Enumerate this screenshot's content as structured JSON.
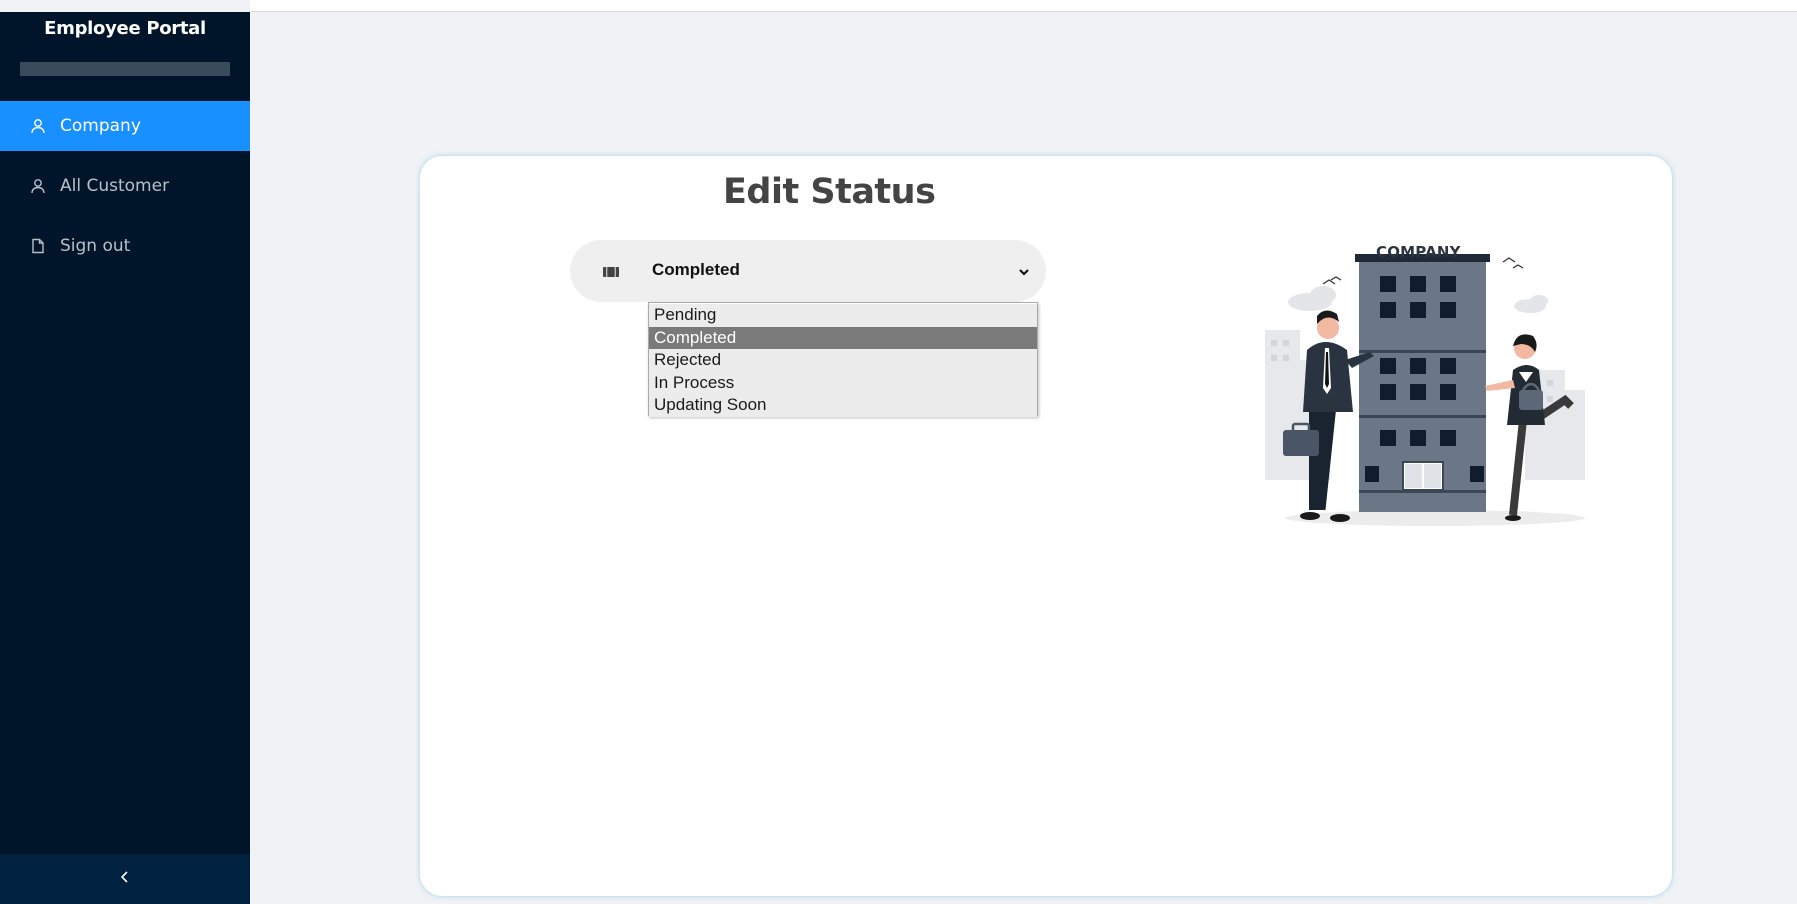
{
  "app": {
    "title": "Employee Portal"
  },
  "sidebar": {
    "items": [
      {
        "label": "Company",
        "icon": "user-icon",
        "active": true
      },
      {
        "label": "All Customer",
        "icon": "user-icon",
        "active": false
      },
      {
        "label": "Sign out",
        "icon": "file-icon",
        "active": false
      }
    ],
    "collapse_icon": "chevron-left-icon"
  },
  "main": {
    "title": "Edit Status",
    "status_select": {
      "selected": "Completed",
      "options": [
        "Pending",
        "Completed",
        "Rejected",
        "In Process",
        "Updating Soon"
      ]
    },
    "illustration": {
      "sign_text": "COMPANY"
    }
  },
  "colors": {
    "sidebar_bg": "#001529",
    "active_item": "#1890ff",
    "page_bg": "#f0f2f5",
    "selected_option": "#7a7a7a"
  }
}
